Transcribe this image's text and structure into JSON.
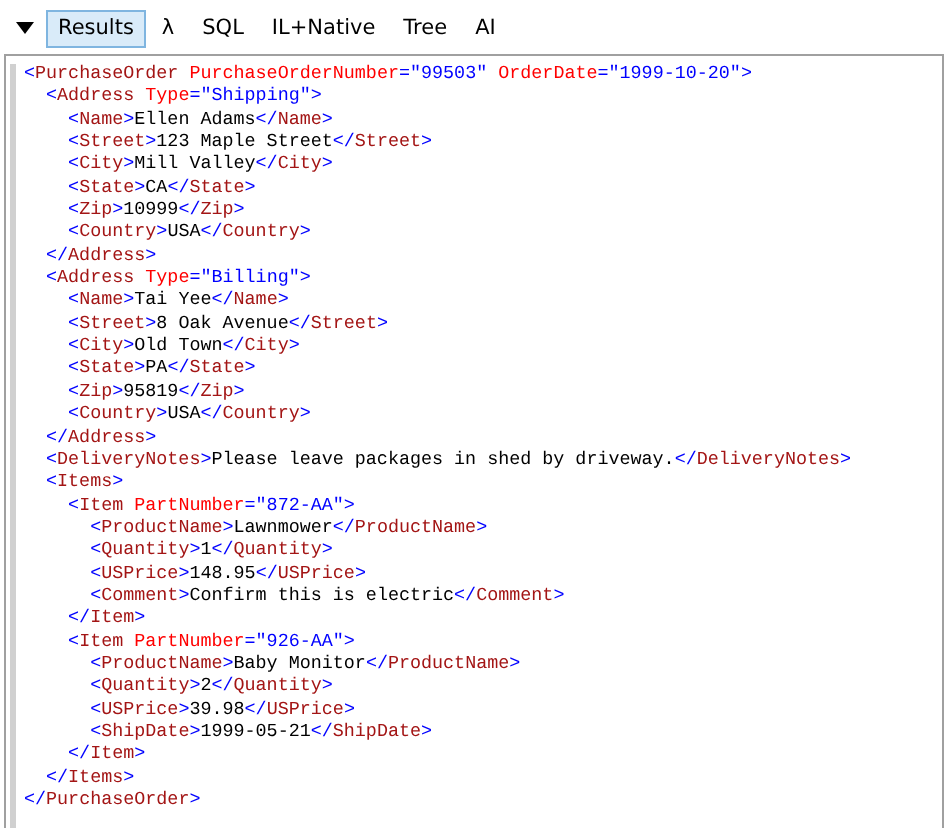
{
  "tabs": [
    {
      "label": "Results",
      "selected": true
    },
    {
      "label": "λ",
      "selected": false
    },
    {
      "label": "SQL",
      "selected": false
    },
    {
      "label": "IL+Native",
      "selected": false
    },
    {
      "label": "Tree",
      "selected": false
    },
    {
      "label": "AI",
      "selected": false
    }
  ],
  "xml": [
    {
      "line": [
        {
          "kind": "punct",
          "text": "<"
        },
        {
          "kind": "tag",
          "text": "PurchaseOrder"
        },
        {
          "kind": "attr",
          "text": " PurchaseOrderNumber"
        },
        {
          "kind": "punct",
          "text": "="
        },
        {
          "kind": "value",
          "text": "\"99503\""
        },
        {
          "kind": "attr",
          "text": " OrderDate"
        },
        {
          "kind": "punct",
          "text": "="
        },
        {
          "kind": "value",
          "text": "\"1999-10-20\""
        },
        {
          "kind": "punct",
          "text": ">"
        }
      ],
      "close": [
        {
          "kind": "punct",
          "text": "</"
        },
        {
          "kind": "tag",
          "text": "PurchaseOrder"
        },
        {
          "kind": "punct",
          "text": ">"
        }
      ],
      "children": [
        {
          "line": [
            {
              "kind": "punct",
              "text": "<"
            },
            {
              "kind": "tag",
              "text": "Address"
            },
            {
              "kind": "attr",
              "text": " Type"
            },
            {
              "kind": "punct",
              "text": "="
            },
            {
              "kind": "value",
              "text": "\"Shipping\""
            },
            {
              "kind": "punct",
              "text": ">"
            }
          ],
          "close": [
            {
              "kind": "punct",
              "text": "</"
            },
            {
              "kind": "tag",
              "text": "Address"
            },
            {
              "kind": "punct",
              "text": ">"
            }
          ],
          "children": [
            {
              "line": [
                {
                  "kind": "punct",
                  "text": "<"
                },
                {
                  "kind": "tag",
                  "text": "Name"
                },
                {
                  "kind": "punct",
                  "text": ">"
                },
                {
                  "kind": "text",
                  "text": "Ellen Adams"
                },
                {
                  "kind": "punct",
                  "text": "</"
                },
                {
                  "kind": "tag",
                  "text": "Name"
                },
                {
                  "kind": "punct",
                  "text": ">"
                }
              ]
            },
            {
              "line": [
                {
                  "kind": "punct",
                  "text": "<"
                },
                {
                  "kind": "tag",
                  "text": "Street"
                },
                {
                  "kind": "punct",
                  "text": ">"
                },
                {
                  "kind": "text",
                  "text": "123 Maple Street"
                },
                {
                  "kind": "punct",
                  "text": "</"
                },
                {
                  "kind": "tag",
                  "text": "Street"
                },
                {
                  "kind": "punct",
                  "text": ">"
                }
              ]
            },
            {
              "line": [
                {
                  "kind": "punct",
                  "text": "<"
                },
                {
                  "kind": "tag",
                  "text": "City"
                },
                {
                  "kind": "punct",
                  "text": ">"
                },
                {
                  "kind": "text",
                  "text": "Mill Valley"
                },
                {
                  "kind": "punct",
                  "text": "</"
                },
                {
                  "kind": "tag",
                  "text": "City"
                },
                {
                  "kind": "punct",
                  "text": ">"
                }
              ]
            },
            {
              "line": [
                {
                  "kind": "punct",
                  "text": "<"
                },
                {
                  "kind": "tag",
                  "text": "State"
                },
                {
                  "kind": "punct",
                  "text": ">"
                },
                {
                  "kind": "text",
                  "text": "CA"
                },
                {
                  "kind": "punct",
                  "text": "</"
                },
                {
                  "kind": "tag",
                  "text": "State"
                },
                {
                  "kind": "punct",
                  "text": ">"
                }
              ]
            },
            {
              "line": [
                {
                  "kind": "punct",
                  "text": "<"
                },
                {
                  "kind": "tag",
                  "text": "Zip"
                },
                {
                  "kind": "punct",
                  "text": ">"
                },
                {
                  "kind": "text",
                  "text": "10999"
                },
                {
                  "kind": "punct",
                  "text": "</"
                },
                {
                  "kind": "tag",
                  "text": "Zip"
                },
                {
                  "kind": "punct",
                  "text": ">"
                }
              ]
            },
            {
              "line": [
                {
                  "kind": "punct",
                  "text": "<"
                },
                {
                  "kind": "tag",
                  "text": "Country"
                },
                {
                  "kind": "punct",
                  "text": ">"
                },
                {
                  "kind": "text",
                  "text": "USA"
                },
                {
                  "kind": "punct",
                  "text": "</"
                },
                {
                  "kind": "tag",
                  "text": "Country"
                },
                {
                  "kind": "punct",
                  "text": ">"
                }
              ]
            }
          ]
        },
        {
          "line": [
            {
              "kind": "punct",
              "text": "<"
            },
            {
              "kind": "tag",
              "text": "Address"
            },
            {
              "kind": "attr",
              "text": " Type"
            },
            {
              "kind": "punct",
              "text": "="
            },
            {
              "kind": "value",
              "text": "\"Billing\""
            },
            {
              "kind": "punct",
              "text": ">"
            }
          ],
          "close": [
            {
              "kind": "punct",
              "text": "</"
            },
            {
              "kind": "tag",
              "text": "Address"
            },
            {
              "kind": "punct",
              "text": ">"
            }
          ],
          "children": [
            {
              "line": [
                {
                  "kind": "punct",
                  "text": "<"
                },
                {
                  "kind": "tag",
                  "text": "Name"
                },
                {
                  "kind": "punct",
                  "text": ">"
                },
                {
                  "kind": "text",
                  "text": "Tai Yee"
                },
                {
                  "kind": "punct",
                  "text": "</"
                },
                {
                  "kind": "tag",
                  "text": "Name"
                },
                {
                  "kind": "punct",
                  "text": ">"
                }
              ]
            },
            {
              "line": [
                {
                  "kind": "punct",
                  "text": "<"
                },
                {
                  "kind": "tag",
                  "text": "Street"
                },
                {
                  "kind": "punct",
                  "text": ">"
                },
                {
                  "kind": "text",
                  "text": "8 Oak Avenue"
                },
                {
                  "kind": "punct",
                  "text": "</"
                },
                {
                  "kind": "tag",
                  "text": "Street"
                },
                {
                  "kind": "punct",
                  "text": ">"
                }
              ]
            },
            {
              "line": [
                {
                  "kind": "punct",
                  "text": "<"
                },
                {
                  "kind": "tag",
                  "text": "City"
                },
                {
                  "kind": "punct",
                  "text": ">"
                },
                {
                  "kind": "text",
                  "text": "Old Town"
                },
                {
                  "kind": "punct",
                  "text": "</"
                },
                {
                  "kind": "tag",
                  "text": "City"
                },
                {
                  "kind": "punct",
                  "text": ">"
                }
              ]
            },
            {
              "line": [
                {
                  "kind": "punct",
                  "text": "<"
                },
                {
                  "kind": "tag",
                  "text": "State"
                },
                {
                  "kind": "punct",
                  "text": ">"
                },
                {
                  "kind": "text",
                  "text": "PA"
                },
                {
                  "kind": "punct",
                  "text": "</"
                },
                {
                  "kind": "tag",
                  "text": "State"
                },
                {
                  "kind": "punct",
                  "text": ">"
                }
              ]
            },
            {
              "line": [
                {
                  "kind": "punct",
                  "text": "<"
                },
                {
                  "kind": "tag",
                  "text": "Zip"
                },
                {
                  "kind": "punct",
                  "text": ">"
                },
                {
                  "kind": "text",
                  "text": "95819"
                },
                {
                  "kind": "punct",
                  "text": "</"
                },
                {
                  "kind": "tag",
                  "text": "Zip"
                },
                {
                  "kind": "punct",
                  "text": ">"
                }
              ]
            },
            {
              "line": [
                {
                  "kind": "punct",
                  "text": "<"
                },
                {
                  "kind": "tag",
                  "text": "Country"
                },
                {
                  "kind": "punct",
                  "text": ">"
                },
                {
                  "kind": "text",
                  "text": "USA"
                },
                {
                  "kind": "punct",
                  "text": "</"
                },
                {
                  "kind": "tag",
                  "text": "Country"
                },
                {
                  "kind": "punct",
                  "text": ">"
                }
              ]
            }
          ]
        },
        {
          "line": [
            {
              "kind": "punct",
              "text": "<"
            },
            {
              "kind": "tag",
              "text": "DeliveryNotes"
            },
            {
              "kind": "punct",
              "text": ">"
            },
            {
              "kind": "text",
              "text": "Please leave packages in shed by driveway."
            },
            {
              "kind": "punct",
              "text": "</"
            },
            {
              "kind": "tag",
              "text": "DeliveryNotes"
            },
            {
              "kind": "punct",
              "text": ">"
            }
          ]
        },
        {
          "line": [
            {
              "kind": "punct",
              "text": "<"
            },
            {
              "kind": "tag",
              "text": "Items"
            },
            {
              "kind": "punct",
              "text": ">"
            }
          ],
          "close": [
            {
              "kind": "punct",
              "text": "</"
            },
            {
              "kind": "tag",
              "text": "Items"
            },
            {
              "kind": "punct",
              "text": ">"
            }
          ],
          "children": [
            {
              "line": [
                {
                  "kind": "punct",
                  "text": "<"
                },
                {
                  "kind": "tag",
                  "text": "Item"
                },
                {
                  "kind": "attr",
                  "text": " PartNumber"
                },
                {
                  "kind": "punct",
                  "text": "="
                },
                {
                  "kind": "value",
                  "text": "\"872-AA\""
                },
                {
                  "kind": "punct",
                  "text": ">"
                }
              ],
              "close": [
                {
                  "kind": "punct",
                  "text": "</"
                },
                {
                  "kind": "tag",
                  "text": "Item"
                },
                {
                  "kind": "punct",
                  "text": ">"
                }
              ],
              "children": [
                {
                  "line": [
                    {
                      "kind": "punct",
                      "text": "<"
                    },
                    {
                      "kind": "tag",
                      "text": "ProductName"
                    },
                    {
                      "kind": "punct",
                      "text": ">"
                    },
                    {
                      "kind": "text",
                      "text": "Lawnmower"
                    },
                    {
                      "kind": "punct",
                      "text": "</"
                    },
                    {
                      "kind": "tag",
                      "text": "ProductName"
                    },
                    {
                      "kind": "punct",
                      "text": ">"
                    }
                  ]
                },
                {
                  "line": [
                    {
                      "kind": "punct",
                      "text": "<"
                    },
                    {
                      "kind": "tag",
                      "text": "Quantity"
                    },
                    {
                      "kind": "punct",
                      "text": ">"
                    },
                    {
                      "kind": "text",
                      "text": "1"
                    },
                    {
                      "kind": "punct",
                      "text": "</"
                    },
                    {
                      "kind": "tag",
                      "text": "Quantity"
                    },
                    {
                      "kind": "punct",
                      "text": ">"
                    }
                  ]
                },
                {
                  "line": [
                    {
                      "kind": "punct",
                      "text": "<"
                    },
                    {
                      "kind": "tag",
                      "text": "USPrice"
                    },
                    {
                      "kind": "punct",
                      "text": ">"
                    },
                    {
                      "kind": "text",
                      "text": "148.95"
                    },
                    {
                      "kind": "punct",
                      "text": "</"
                    },
                    {
                      "kind": "tag",
                      "text": "USPrice"
                    },
                    {
                      "kind": "punct",
                      "text": ">"
                    }
                  ]
                },
                {
                  "line": [
                    {
                      "kind": "punct",
                      "text": "<"
                    },
                    {
                      "kind": "tag",
                      "text": "Comment"
                    },
                    {
                      "kind": "punct",
                      "text": ">"
                    },
                    {
                      "kind": "text",
                      "text": "Confirm this is electric"
                    },
                    {
                      "kind": "punct",
                      "text": "</"
                    },
                    {
                      "kind": "tag",
                      "text": "Comment"
                    },
                    {
                      "kind": "punct",
                      "text": ">"
                    }
                  ]
                }
              ]
            },
            {
              "line": [
                {
                  "kind": "punct",
                  "text": "<"
                },
                {
                  "kind": "tag",
                  "text": "Item"
                },
                {
                  "kind": "attr",
                  "text": " PartNumber"
                },
                {
                  "kind": "punct",
                  "text": "="
                },
                {
                  "kind": "value",
                  "text": "\"926-AA\""
                },
                {
                  "kind": "punct",
                  "text": ">"
                }
              ],
              "close": [
                {
                  "kind": "punct",
                  "text": "</"
                },
                {
                  "kind": "tag",
                  "text": "Item"
                },
                {
                  "kind": "punct",
                  "text": ">"
                }
              ],
              "children": [
                {
                  "line": [
                    {
                      "kind": "punct",
                      "text": "<"
                    },
                    {
                      "kind": "tag",
                      "text": "ProductName"
                    },
                    {
                      "kind": "punct",
                      "text": ">"
                    },
                    {
                      "kind": "text",
                      "text": "Baby Monitor"
                    },
                    {
                      "kind": "punct",
                      "text": "</"
                    },
                    {
                      "kind": "tag",
                      "text": "ProductName"
                    },
                    {
                      "kind": "punct",
                      "text": ">"
                    }
                  ]
                },
                {
                  "line": [
                    {
                      "kind": "punct",
                      "text": "<"
                    },
                    {
                      "kind": "tag",
                      "text": "Quantity"
                    },
                    {
                      "kind": "punct",
                      "text": ">"
                    },
                    {
                      "kind": "text",
                      "text": "2"
                    },
                    {
                      "kind": "punct",
                      "text": "</"
                    },
                    {
                      "kind": "tag",
                      "text": "Quantity"
                    },
                    {
                      "kind": "punct",
                      "text": ">"
                    }
                  ]
                },
                {
                  "line": [
                    {
                      "kind": "punct",
                      "text": "<"
                    },
                    {
                      "kind": "tag",
                      "text": "USPrice"
                    },
                    {
                      "kind": "punct",
                      "text": ">"
                    },
                    {
                      "kind": "text",
                      "text": "39.98"
                    },
                    {
                      "kind": "punct",
                      "text": "</"
                    },
                    {
                      "kind": "tag",
                      "text": "USPrice"
                    },
                    {
                      "kind": "punct",
                      "text": ">"
                    }
                  ]
                },
                {
                  "line": [
                    {
                      "kind": "punct",
                      "text": "<"
                    },
                    {
                      "kind": "tag",
                      "text": "ShipDate"
                    },
                    {
                      "kind": "punct",
                      "text": ">"
                    },
                    {
                      "kind": "text",
                      "text": "1999-05-21"
                    },
                    {
                      "kind": "punct",
                      "text": "</"
                    },
                    {
                      "kind": "tag",
                      "text": "ShipDate"
                    },
                    {
                      "kind": "punct",
                      "text": ">"
                    }
                  ]
                }
              ]
            }
          ]
        }
      ]
    }
  ]
}
